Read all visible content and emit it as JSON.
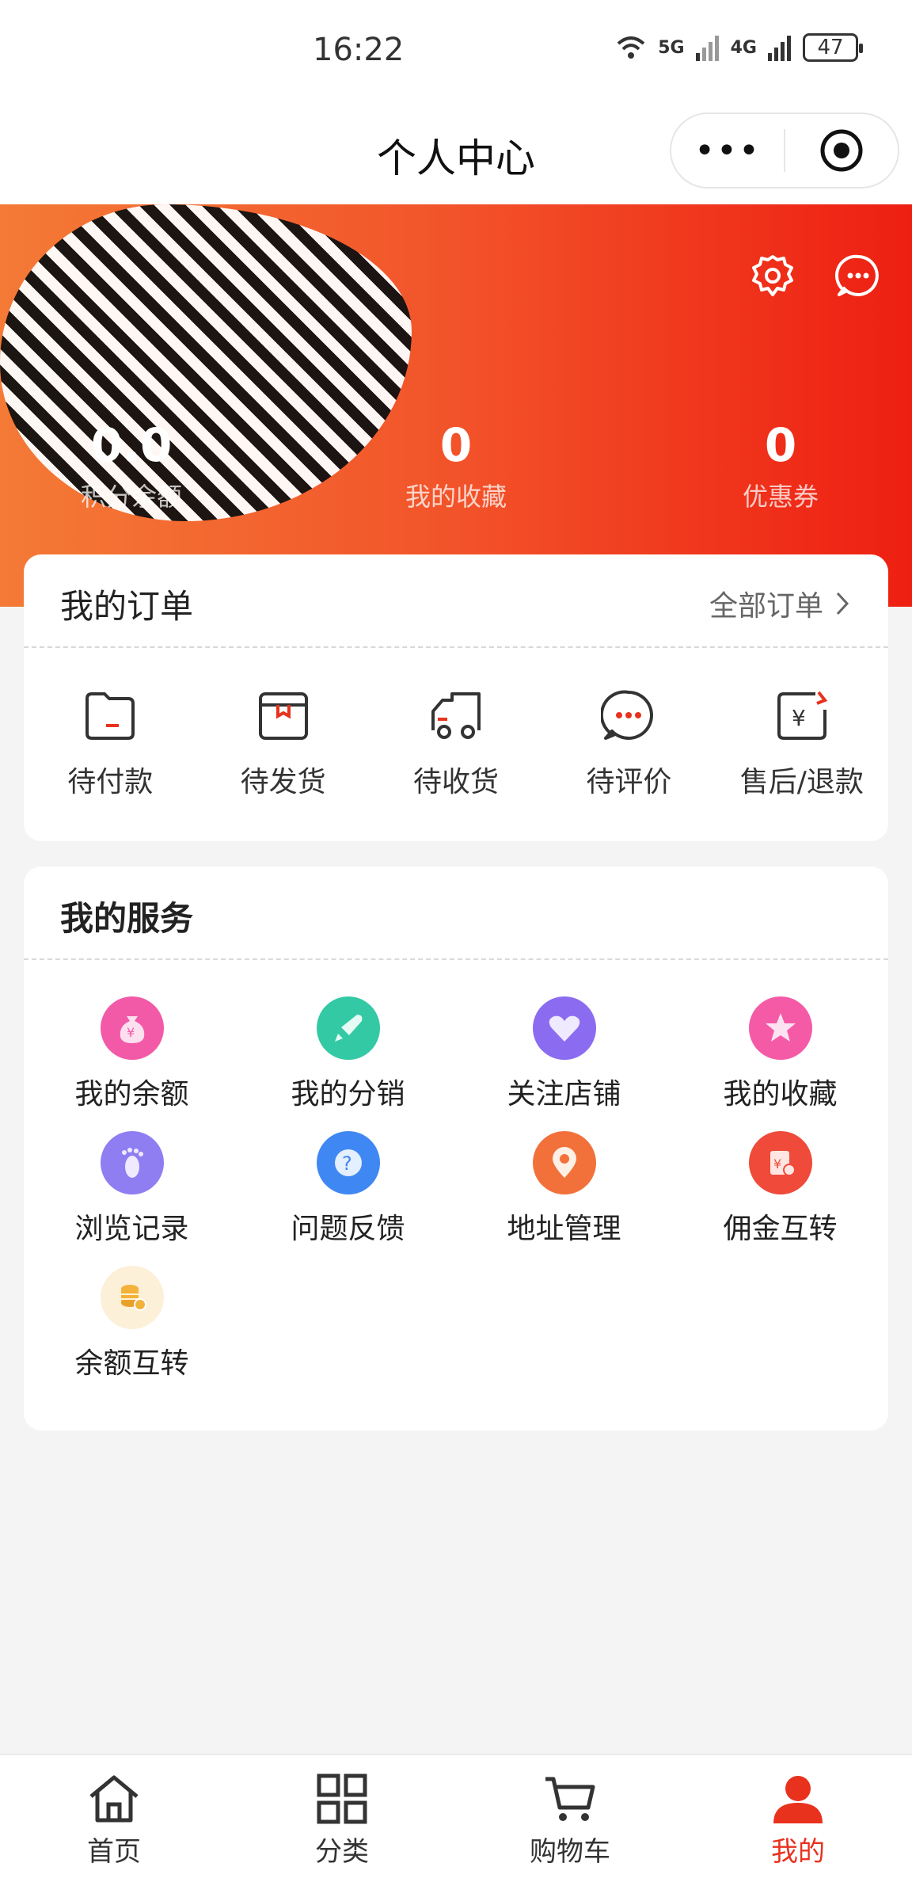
{
  "status_bar": {
    "time": "16:22",
    "signal_1": "5G",
    "signal_2": "4G",
    "battery": "47"
  },
  "nav": {
    "title": "个人中心",
    "more_label": "•••"
  },
  "header": {
    "stats": [
      {
        "value": "0.0",
        "label": "积分余额"
      },
      {
        "value": "0",
        "label": "我的收藏"
      },
      {
        "value": "0",
        "label": "优惠券"
      }
    ],
    "icons": [
      "settings-icon",
      "message-icon"
    ]
  },
  "orders": {
    "title": "我的订单",
    "all_label": "全部订单",
    "items": [
      {
        "label": "待付款",
        "icon": "wallet-icon"
      },
      {
        "label": "待发货",
        "icon": "box-icon"
      },
      {
        "label": "待收货",
        "icon": "truck-icon"
      },
      {
        "label": "待评价",
        "icon": "comment-icon"
      },
      {
        "label": "售后/退款",
        "icon": "refund-icon"
      }
    ]
  },
  "services": {
    "title": "我的服务",
    "items": [
      {
        "label": "我的余额",
        "icon": "money-bag-icon",
        "color": "#f25aa8"
      },
      {
        "label": "我的分销",
        "icon": "rocket-icon",
        "color": "#33c9a5"
      },
      {
        "label": "关注店铺",
        "icon": "heart-icon",
        "color": "#8b6cf0"
      },
      {
        "label": "我的收藏",
        "icon": "star-icon",
        "color": "#f55aa6"
      },
      {
        "label": "浏览记录",
        "icon": "footprint-icon",
        "color": "#8f7df2"
      },
      {
        "label": "问题反馈",
        "icon": "question-icon",
        "color": "#3f87f2"
      },
      {
        "label": "地址管理",
        "icon": "location-icon",
        "color": "#f2713a"
      },
      {
        "label": "佣金互转",
        "icon": "commission-icon",
        "color": "#ef4a3a"
      },
      {
        "label": "余额互转",
        "icon": "coins-icon",
        "color": "#fbe2b8"
      }
    ]
  },
  "tabbar": {
    "items": [
      {
        "label": "首页",
        "icon": "home-icon"
      },
      {
        "label": "分类",
        "icon": "grid-icon"
      },
      {
        "label": "购物车",
        "icon": "cart-icon"
      },
      {
        "label": "我的",
        "icon": "user-icon",
        "active": true
      }
    ]
  },
  "colors": {
    "accent": "#e8321e",
    "header_start": "#f47a36",
    "header_end": "#ee1f12"
  }
}
